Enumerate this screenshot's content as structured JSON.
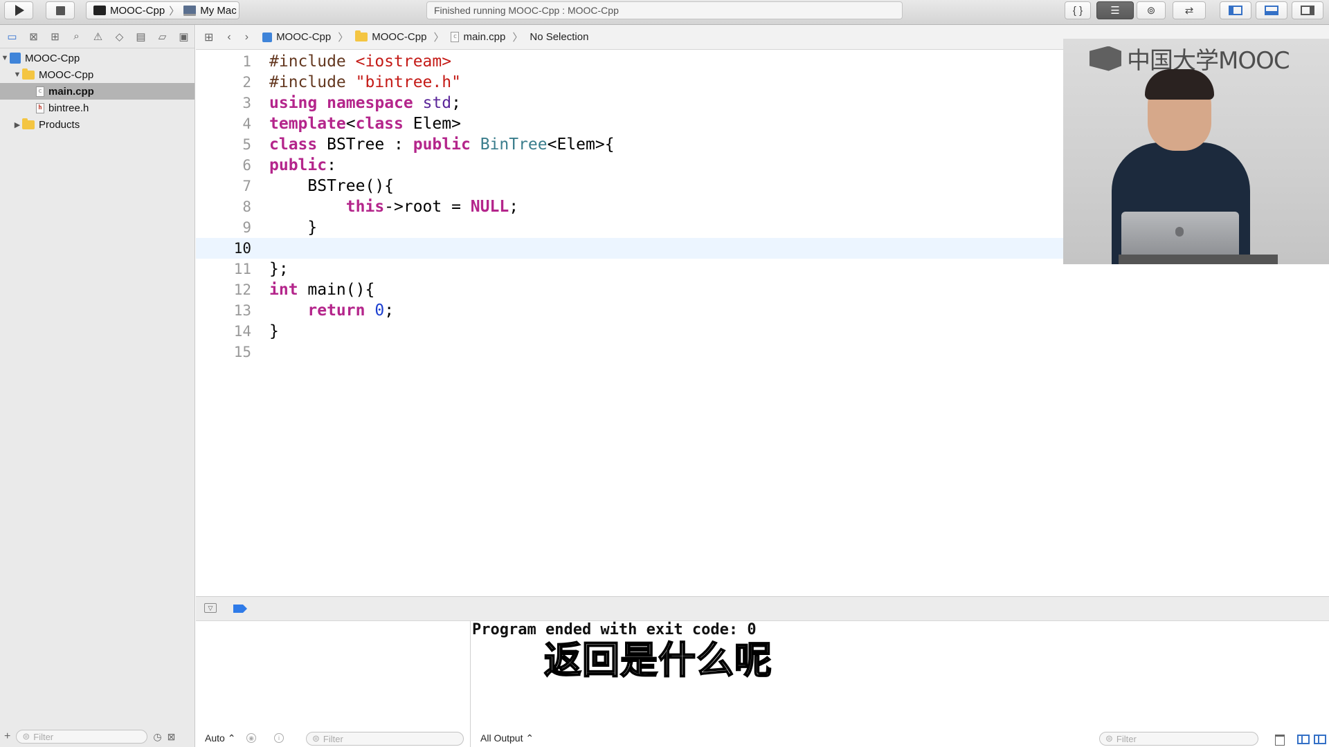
{
  "toolbar": {
    "scheme": "MOOC-Cpp",
    "destination": "My Mac",
    "activity": "Finished running MOOC-Cpp : MOOC-Cpp",
    "braces_label": "{ }"
  },
  "navigator": {
    "items": [
      {
        "label": "MOOC-Cpp",
        "kind": "project",
        "expanded": true,
        "level": 0
      },
      {
        "label": "MOOC-Cpp",
        "kind": "folder",
        "expanded": true,
        "level": 1
      },
      {
        "label": "main.cpp",
        "kind": "file",
        "selected": true,
        "level": 2
      },
      {
        "label": "bintree.h",
        "kind": "header",
        "level": 2
      },
      {
        "label": "Products",
        "kind": "folder",
        "expanded": false,
        "level": 1
      }
    ],
    "filter_placeholder": "Filter"
  },
  "jumpbar": {
    "crumbs": [
      "MOOC-Cpp",
      "MOOC-Cpp",
      "main.cpp",
      "No Selection"
    ]
  },
  "editor": {
    "current_line": 10,
    "lines": [
      {
        "n": "1"
      },
      {
        "n": "2"
      },
      {
        "n": "3"
      },
      {
        "n": "4"
      },
      {
        "n": "5"
      },
      {
        "n": "6"
      },
      {
        "n": "7"
      },
      {
        "n": "8"
      },
      {
        "n": "9"
      },
      {
        "n": "10"
      },
      {
        "n": "11"
      },
      {
        "n": "12"
      },
      {
        "n": "13"
      },
      {
        "n": "14"
      },
      {
        "n": "15"
      }
    ],
    "code": {
      "l1a": "#include ",
      "l1b": "<iostream>",
      "l2a": "#include ",
      "l2b": "\"bintree.h\"",
      "l3a": "using",
      "l3b": " ",
      "l3c": "namespace",
      "l3d": " ",
      "l3e": "std",
      "l3f": ";",
      "l4a": "template",
      "l4b": "<",
      "l4c": "class",
      "l4d": " Elem>",
      "l5a": "class",
      "l5b": " BSTree : ",
      "l5c": "public",
      "l5d": " ",
      "l5e": "BinTree",
      "l5f": "<Elem>{",
      "l6a": "public",
      "l6b": ":",
      "l7a": "    BSTree(){",
      "l8a": "        ",
      "l8b": "this",
      "l8c": "->root = ",
      "l8d": "NULL",
      "l8e": ";",
      "l9a": "    }",
      "l11a": "};",
      "l12a": "int",
      "l12b": " main(){",
      "l13a": "    ",
      "l13b": "return",
      "l13c": " ",
      "l13d": "0",
      "l13e": ";",
      "l14a": "}"
    }
  },
  "video": {
    "logo_text": "中国大学MOOC"
  },
  "debug": {
    "console_output": "Program ended with exit code: 0",
    "subtitle": "返回是什么呢",
    "auto_label": "Auto ⌃",
    "output_selector": "All Output ⌃",
    "filter_placeholder": "Filter"
  }
}
